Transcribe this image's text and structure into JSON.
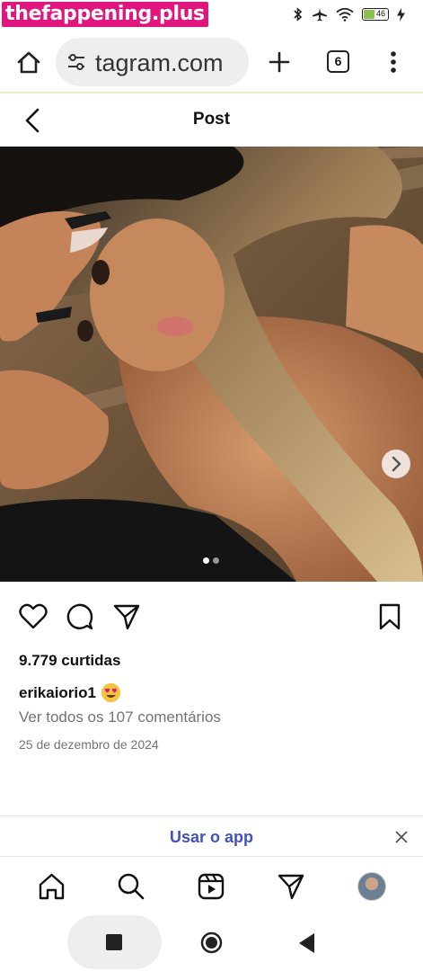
{
  "watermark": "thefappening.plus",
  "status": {
    "battery_level": "46",
    "icons": [
      "bluetooth-icon",
      "airplane-icon",
      "wifi-icon",
      "battery-icon",
      "charging-icon"
    ]
  },
  "browser": {
    "url": "tagram.com",
    "tab_count": "6",
    "icons": [
      "home-icon",
      "site-settings-icon",
      "new-tab-icon",
      "tabs-icon",
      "menu-icon"
    ]
  },
  "post": {
    "header_title": "Post",
    "likes": "9.779 curtidas",
    "username": "erikaiorio1",
    "caption_emoji": "heart-eyes-emoji",
    "comments_link": "Ver todos os 107 comentários",
    "date": "25 de dezembro de 2024",
    "carousel": {
      "total": 2,
      "current": 1
    }
  },
  "banner": {
    "use_app": "Usar o app"
  },
  "colors": {
    "accent": "#4150c4",
    "watermark": "#e0167e",
    "muted": "#737373"
  }
}
